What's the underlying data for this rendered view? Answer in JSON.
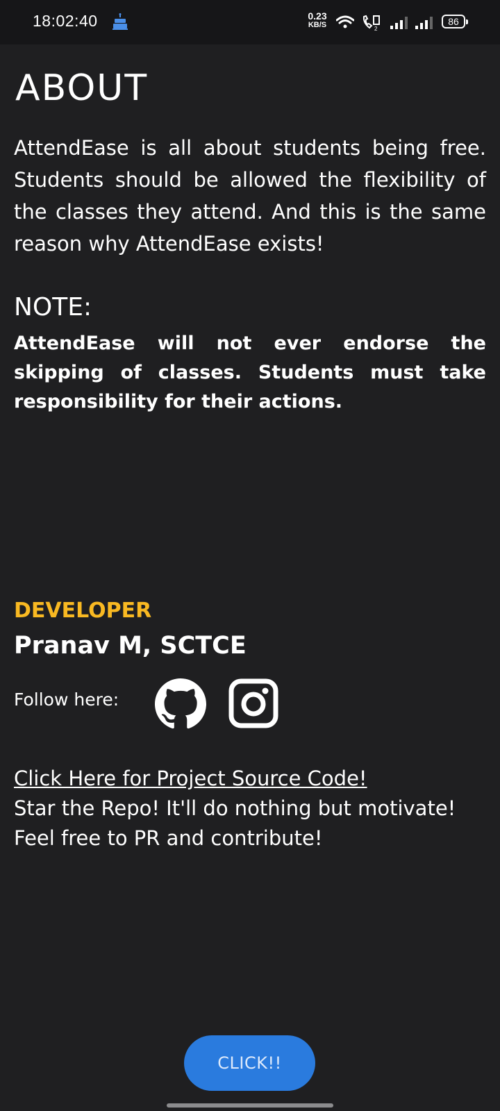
{
  "status_bar": {
    "time": "18:02:40",
    "net_speed_value": "0.23",
    "net_speed_unit": "KB/S",
    "battery": "86",
    "icons": [
      "cake-icon",
      "wifi-icon",
      "call-icon",
      "signal-icon",
      "signal-icon",
      "battery-icon"
    ]
  },
  "about": {
    "title": "ABOUT",
    "text": "AttendEase is all about students being free. Students should be allowed the flexibility of the classes they attend. And this is the same reason why AttendEase exists!"
  },
  "note": {
    "title": "NOTE:",
    "text": "AttendEase will not ever endorse the skipping of classes. Students must take responsibility for their actions."
  },
  "developer": {
    "label": "DEVELOPER",
    "name": "Pranav M, SCTCE",
    "follow_label": "Follow here:",
    "social_icons": [
      "github-icon",
      "instagram-icon"
    ]
  },
  "links": {
    "source_code": "Click Here for Project Source Code!",
    "star_repo": "Star the Repo! It'll do nothing but motivate!",
    "contribute": "Feel free to PR and contribute!"
  },
  "button": {
    "label": "CLICK!!"
  },
  "colors": {
    "background": "#1f1f21",
    "accent_developer": "#f9b922",
    "button_bg": "#2a7bde"
  }
}
